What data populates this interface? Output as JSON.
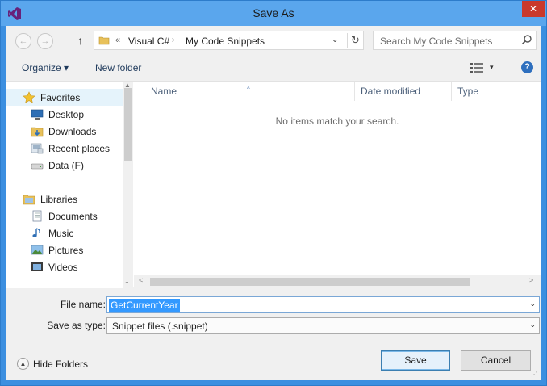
{
  "window": {
    "title": "Save As",
    "close_glyph": "✕",
    "colors": {
      "titlebar": "#5aa6ed",
      "accent": "#3399ff",
      "close": "#c9392c"
    }
  },
  "nav": {
    "back_icon": "←",
    "forward_icon": "→",
    "up_icon": "↑",
    "breadcrumb_prefix": "«",
    "breadcrumb": [
      "Visual C#",
      "My Code Snippets"
    ],
    "breadcrumb_separator": "›",
    "dropdown_icon": "⌄",
    "refresh_icon": "↻"
  },
  "search": {
    "placeholder": "Search My Code Snippets"
  },
  "toolbar": {
    "organize_label": "Organize ▾",
    "new_folder_label": "New folder",
    "view_dropdown": "▾",
    "help_glyph": "?"
  },
  "sidebar": {
    "favorites": {
      "label": "Favorites",
      "items": [
        {
          "label": "Desktop",
          "icon": "desktop-icon"
        },
        {
          "label": "Downloads",
          "icon": "downloads-icon"
        },
        {
          "label": "Recent places",
          "icon": "recent-places-icon"
        },
        {
          "label": "Data (F)",
          "icon": "drive-icon"
        }
      ]
    },
    "libraries": {
      "label": "Libraries",
      "items": [
        {
          "label": "Documents",
          "icon": "documents-icon"
        },
        {
          "label": "Music",
          "icon": "music-icon"
        },
        {
          "label": "Pictures",
          "icon": "pictures-icon"
        },
        {
          "label": "Videos",
          "icon": "videos-icon"
        }
      ]
    }
  },
  "file_list": {
    "columns": [
      "Name",
      "Date modified",
      "Type"
    ],
    "sort_indicator": "^",
    "empty_message": "No items match your search."
  },
  "scrollbar": {
    "up": "▲",
    "down": "⌄",
    "left": "<",
    "right": ">"
  },
  "form": {
    "file_name_label": "File name:",
    "file_name_value": "GetCurrentYear",
    "save_type_label": "Save as type:",
    "save_type_value": "Snippet files (.snippet)",
    "dropdown_glyph": "⌄"
  },
  "footer": {
    "hide_folders_label": "Hide Folders",
    "hide_folders_glyph": "▲",
    "save_label": "Save",
    "cancel_label": "Cancel",
    "grip_glyph": "⋰"
  }
}
